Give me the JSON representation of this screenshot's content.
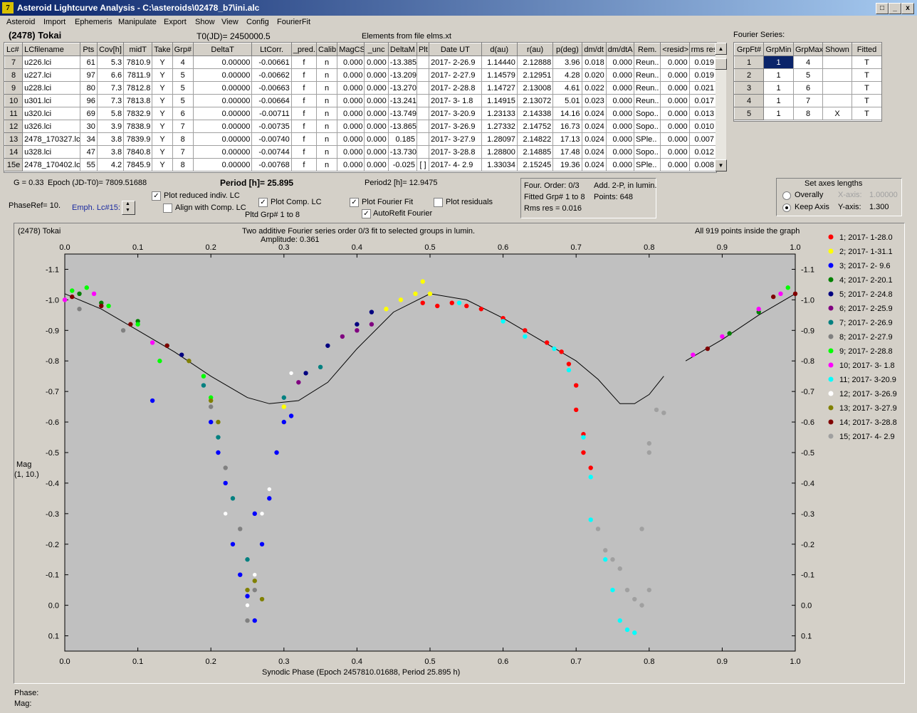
{
  "window": {
    "title": "Asteroid Lightcurve Analysis - C:\\asteroids\\02478_b7\\ini.alc",
    "icon": "7"
  },
  "menu": [
    "Asteroid",
    "Import",
    "Ephemeris",
    "Manipulate",
    "Export",
    "Show",
    "View",
    "Config",
    "FourierFit"
  ],
  "header": {
    "object": "(2478) Tokai",
    "t0": "T0(JD)= 2450000.5",
    "elements": "Elements from file elms.xt"
  },
  "table": {
    "columns": [
      "Lc#",
      "LCfilename",
      "Pts",
      "Cov[h]",
      "midT",
      "Take",
      "Grp#",
      "DeltaT",
      "LtCorr.",
      "_pred.",
      "Calib",
      "MagCS",
      "_unc",
      "DeltaM",
      "Plt",
      "Date UT",
      "d(au)",
      "r(au)",
      "p(deg)",
      "dm/dt",
      "dm/dtA",
      "Rem.",
      "<resid>",
      "rms res"
    ],
    "rows": [
      [
        "7",
        "u226.lci",
        "61",
        "5.3",
        "7810.9",
        "Y",
        "4",
        "0.00000",
        "-0.00661",
        "f",
        "n",
        "0.000",
        "0.000",
        "-13.385",
        "",
        "2017- 2-26.9",
        "1.14440",
        "2.12888",
        "3.96",
        "0.018",
        "0.000",
        "Reun..",
        "0.000",
        "0.019"
      ],
      [
        "8",
        "u227.lci",
        "97",
        "6.6",
        "7811.9",
        "Y",
        "5",
        "0.00000",
        "-0.00662",
        "f",
        "n",
        "0.000",
        "0.000",
        "-13.209",
        "",
        "2017- 2-27.9",
        "1.14579",
        "2.12951",
        "4.28",
        "0.020",
        "0.000",
        "Reun..",
        "0.000",
        "0.019"
      ],
      [
        "9",
        "u228.lci",
        "80",
        "7.3",
        "7812.8",
        "Y",
        "5",
        "0.00000",
        "-0.00663",
        "f",
        "n",
        "0.000",
        "0.000",
        "-13.270",
        "",
        "2017- 2-28.8",
        "1.14727",
        "2.13008",
        "4.61",
        "0.022",
        "0.000",
        "Reun..",
        "0.000",
        "0.021"
      ],
      [
        "10",
        "u301.lci",
        "96",
        "7.3",
        "7813.8",
        "Y",
        "5",
        "0.00000",
        "-0.00664",
        "f",
        "n",
        "0.000",
        "0.000",
        "-13.241",
        "",
        "2017- 3- 1.8",
        "1.14915",
        "2.13072",
        "5.01",
        "0.023",
        "0.000",
        "Reun..",
        "0.000",
        "0.017"
      ],
      [
        "11",
        "u320.lci",
        "69",
        "5.8",
        "7832.9",
        "Y",
        "6",
        "0.00000",
        "-0.00711",
        "f",
        "n",
        "0.000",
        "0.000",
        "-13.749",
        "",
        "2017- 3-20.9",
        "1.23133",
        "2.14338",
        "14.16",
        "0.024",
        "0.000",
        "Sopo..",
        "0.000",
        "0.013"
      ],
      [
        "12",
        "u326.lci",
        "30",
        "3.9",
        "7838.9",
        "Y",
        "7",
        "0.00000",
        "-0.00735",
        "f",
        "n",
        "0.000",
        "0.000",
        "-13.865",
        "",
        "2017- 3-26.9",
        "1.27332",
        "2.14752",
        "16.73",
        "0.024",
        "0.000",
        "Sopo..",
        "0.000",
        "0.010"
      ],
      [
        "13",
        "2478_170327.lc",
        "34",
        "3.8",
        "7839.9",
        "Y",
        "8",
        "0.00000",
        "-0.00740",
        "f",
        "n",
        "0.000",
        "0.000",
        "0.185",
        "",
        "2017- 3-27.9",
        "1.28097",
        "2.14822",
        "17.13",
        "0.024",
        "0.000",
        "SPle..",
        "0.000",
        "0.007"
      ],
      [
        "14",
        "u328.lci",
        "47",
        "3.8",
        "7840.8",
        "Y",
        "7",
        "0.00000",
        "-0.00744",
        "f",
        "n",
        "0.000",
        "0.000",
        "-13.730",
        "",
        "2017- 3-28.8",
        "1.28800",
        "2.14885",
        "17.48",
        "0.024",
        "0.000",
        "Sopo..",
        "0.000",
        "0.012"
      ],
      [
        "15e",
        "2478_170402.lc",
        "55",
        "4.2",
        "7845.9",
        "Y",
        "8",
        "0.00000",
        "-0.00768",
        "f",
        "n",
        "0.000",
        "0.000",
        "-0.025",
        "[ ]",
        "2017- 4- 2.9",
        "1.33034",
        "2.15245",
        "19.36",
        "0.024",
        "0.000",
        "SPle..",
        "0.000",
        "0.008"
      ]
    ]
  },
  "fourier_table": {
    "title": "Fourier Series:",
    "columns": [
      "GrpFt#",
      "GrpMin",
      "GrpMax",
      "Shown",
      "Fitted"
    ],
    "rows": [
      [
        "1",
        "1",
        "4",
        "",
        "T"
      ],
      [
        "2",
        "1",
        "5",
        "",
        "T"
      ],
      [
        "3",
        "1",
        "6",
        "",
        "T"
      ],
      [
        "4",
        "1",
        "7",
        "",
        "T"
      ],
      [
        "5",
        "1",
        "8",
        "X",
        "T"
      ]
    ]
  },
  "params": {
    "g": "G = 0.33",
    "epoch": "Epoch (JD-T0)= 7809.51688",
    "period": "Period [h]= 25.895",
    "period2": "Period2 [h]= 12.9475",
    "phaseref": "PhaseRef= 10.",
    "emph": "Emph. Lc#15:",
    "plot_reduced": "Plot reduced indiv. LC",
    "align": "Align with Comp. LC",
    "plot_comp": "Plot Comp. LC",
    "pltd_grp": "Pltd Grp#  1   to   8",
    "plot_fourier": "Plot Fourier Fit",
    "autorefit": "AutoRefit Fourier",
    "plot_residuals": "Plot residuals"
  },
  "fourier_info": {
    "order": "Four. Order:  0/3",
    "add": "Add. 2-P, in lumin.",
    "fitted": "Fitted Grp# 1 to 8",
    "points": "Points: 648",
    "rms": "Rms res    = 0.016"
  },
  "axes_panel": {
    "title": "Set axes lengths",
    "overally": "Overally",
    "keep": "Keep Axis",
    "xaxis_label": "X-axis:",
    "xaxis_val": "1.00000",
    "yaxis_label": "Y-axis:",
    "yaxis_val": "1.300"
  },
  "chart_data": {
    "type": "scatter",
    "title_left": "(2478) Tokai",
    "title": "Two additive Fourier series order 0/3 fit to selected groups in lumin.",
    "subtitle": "Amplitude: 0.361",
    "title_right": "All 919 points inside the graph",
    "xlabel": "Synodic Phase (Epoch 2457810.01688, Period 25.895 h)",
    "ylabel": "Mag",
    "ylabel2": "(1, 10.)",
    "xlim": [
      0,
      1
    ],
    "ylim": [
      -1.15,
      0.15
    ],
    "xticks": [
      "0.0",
      "0.1",
      "0.2",
      "0.3",
      "0.4",
      "0.5",
      "0.6",
      "0.7",
      "0.8",
      "0.9",
      "1.0"
    ],
    "yticks": [
      "-1.1",
      "-1.0",
      "-0.9",
      "-0.8",
      "-0.7",
      "-0.6",
      "-0.5",
      "-0.4",
      "-0.3",
      "-0.2",
      "-0.1",
      "0.0",
      "0.1"
    ],
    "legend": [
      {
        "label": "1; 2017- 1-28.0",
        "color": "#ff0000"
      },
      {
        "label": "2; 2017- 1-31.1",
        "color": "#ffff00"
      },
      {
        "label": "3; 2017- 2- 9.6",
        "color": "#0000ff"
      },
      {
        "label": "4; 2017- 2-20.1",
        "color": "#008000"
      },
      {
        "label": "5; 2017- 2-24.8",
        "color": "#000080"
      },
      {
        "label": "6; 2017- 2-25.9",
        "color": "#800080"
      },
      {
        "label": "7; 2017- 2-26.9",
        "color": "#008080"
      },
      {
        "label": "8; 2017- 2-27.9",
        "color": "#808080"
      },
      {
        "label": "9; 2017- 2-28.8",
        "color": "#00ff00"
      },
      {
        "label": "10; 2017- 3- 1.8",
        "color": "#ff00ff"
      },
      {
        "label": "11; 2017- 3-20.9",
        "color": "#00ffff"
      },
      {
        "label": "12; 2017- 3-26.9",
        "color": "#ffffff"
      },
      {
        "label": "13; 2017- 3-27.9",
        "color": "#808000"
      },
      {
        "label": "14; 2017- 3-28.8",
        "color": "#800000"
      },
      {
        "label": "15; 2017- 4- 2.9",
        "color": "#a0a0a0"
      }
    ],
    "fit_curve": [
      [
        0,
        -1.02
      ],
      [
        0.05,
        -0.97
      ],
      [
        0.1,
        -0.9
      ],
      [
        0.15,
        -0.83
      ],
      [
        0.2,
        -0.75
      ],
      [
        0.25,
        -0.68
      ],
      [
        0.28,
        -0.66
      ],
      [
        0.32,
        -0.67
      ],
      [
        0.36,
        -0.73
      ],
      [
        0.4,
        -0.84
      ],
      [
        0.45,
        -0.96
      ],
      [
        0.5,
        -1.02
      ],
      [
        0.55,
        -1.0
      ],
      [
        0.6,
        -0.94
      ],
      [
        0.65,
        -0.87
      ],
      [
        0.7,
        -0.8
      ],
      [
        0.73,
        -0.74
      ],
      [
        0.76,
        -0.66
      ],
      [
        0.78,
        -0.66
      ],
      [
        0.8,
        -0.69
      ],
      [
        0.82,
        -0.75
      ]
    ],
    "fit_curve2": [
      [
        0.85,
        -0.8
      ],
      [
        0.9,
        -0.87
      ],
      [
        0.95,
        -0.95
      ],
      [
        1.0,
        -1.02
      ]
    ],
    "series": [
      {
        "group": 1,
        "points": [
          [
            0.49,
            -0.99
          ],
          [
            0.51,
            -0.98
          ],
          [
            0.53,
            -0.99
          ],
          [
            0.55,
            -0.98
          ],
          [
            0.57,
            -0.97
          ],
          [
            0.6,
            -0.94
          ],
          [
            0.63,
            -0.9
          ],
          [
            0.66,
            -0.86
          ],
          [
            0.68,
            -0.83
          ],
          [
            0.69,
            -0.79
          ],
          [
            0.7,
            -0.72
          ],
          [
            0.7,
            -0.64
          ],
          [
            0.71,
            -0.56
          ],
          [
            0.71,
            -0.5
          ],
          [
            0.72,
            -0.45
          ]
        ]
      },
      {
        "group": 2,
        "points": [
          [
            0.44,
            -0.97
          ],
          [
            0.46,
            -1.0
          ],
          [
            0.48,
            -1.02
          ],
          [
            0.49,
            -1.06
          ],
          [
            0.5,
            -1.02
          ],
          [
            0.3,
            -0.65
          ],
          [
            0.3,
            -0.6
          ]
        ]
      },
      {
        "group": 3,
        "points": [
          [
            0.12,
            -0.67
          ],
          [
            0.2,
            -0.6
          ],
          [
            0.21,
            -0.5
          ],
          [
            0.22,
            -0.4
          ],
          [
            0.22,
            -0.3
          ],
          [
            0.23,
            -0.2
          ],
          [
            0.24,
            -0.1
          ],
          [
            0.25,
            -0.03
          ],
          [
            0.26,
            0.05
          ],
          [
            0.27,
            -0.2
          ],
          [
            0.28,
            -0.35
          ],
          [
            0.29,
            -0.5
          ],
          [
            0.3,
            -0.6
          ],
          [
            0.31,
            -0.62
          ],
          [
            0.26,
            -0.3
          ]
        ]
      },
      {
        "group": 4,
        "points": [
          [
            0.02,
            -1.02
          ],
          [
            0.05,
            -0.99
          ],
          [
            0.1,
            -0.93
          ],
          [
            0.14,
            -0.85
          ],
          [
            0.91,
            -0.89
          ],
          [
            0.95,
            -0.96
          ]
        ]
      },
      {
        "group": 5,
        "points": [
          [
            0.16,
            -0.82
          ],
          [
            0.33,
            -0.76
          ],
          [
            0.36,
            -0.85
          ],
          [
            0.4,
            -0.92
          ],
          [
            0.42,
            -0.96
          ]
        ]
      },
      {
        "group": 6,
        "points": [
          [
            0.32,
            -0.73
          ],
          [
            0.38,
            -0.88
          ],
          [
            0.4,
            -0.9
          ],
          [
            0.42,
            -0.92
          ]
        ]
      },
      {
        "group": 7,
        "points": [
          [
            0.19,
            -0.72
          ],
          [
            0.21,
            -0.55
          ],
          [
            0.23,
            -0.35
          ],
          [
            0.25,
            -0.15
          ],
          [
            0.3,
            -0.68
          ],
          [
            0.35,
            -0.78
          ]
        ]
      },
      {
        "group": 8,
        "points": [
          [
            0.02,
            -0.97
          ],
          [
            0.08,
            -0.9
          ],
          [
            0.2,
            -0.65
          ],
          [
            0.22,
            -0.45
          ],
          [
            0.24,
            -0.25
          ],
          [
            0.25,
            0.05
          ],
          [
            0.26,
            -0.05
          ]
        ]
      },
      {
        "group": 9,
        "points": [
          [
            0.01,
            -1.03
          ],
          [
            0.03,
            -1.04
          ],
          [
            0.06,
            -0.98
          ],
          [
            0.1,
            -0.92
          ],
          [
            0.13,
            -0.8
          ],
          [
            0.19,
            -0.75
          ],
          [
            0.2,
            -0.68
          ],
          [
            0.99,
            -1.04
          ]
        ]
      },
      {
        "group": 10,
        "points": [
          [
            0.0,
            -1.0
          ],
          [
            0.04,
            -1.02
          ],
          [
            0.12,
            -0.86
          ],
          [
            0.86,
            -0.82
          ],
          [
            0.9,
            -0.88
          ],
          [
            0.95,
            -0.97
          ],
          [
            0.98,
            -1.02
          ]
        ]
      },
      {
        "group": 11,
        "points": [
          [
            0.54,
            -0.99
          ],
          [
            0.6,
            -0.93
          ],
          [
            0.63,
            -0.88
          ],
          [
            0.67,
            -0.84
          ],
          [
            0.69,
            -0.77
          ],
          [
            0.71,
            -0.55
          ],
          [
            0.72,
            -0.42
          ],
          [
            0.72,
            -0.28
          ],
          [
            0.74,
            -0.15
          ],
          [
            0.75,
            -0.05
          ],
          [
            0.76,
            0.05
          ],
          [
            0.77,
            0.08
          ],
          [
            0.78,
            0.09
          ]
        ]
      },
      {
        "group": 12,
        "points": [
          [
            0.22,
            -0.3
          ],
          [
            0.25,
            0.0
          ],
          [
            0.26,
            -0.1
          ],
          [
            0.27,
            -0.3
          ],
          [
            0.28,
            -0.38
          ],
          [
            0.31,
            -0.76
          ]
        ]
      },
      {
        "group": 13,
        "points": [
          [
            0.17,
            -0.8
          ],
          [
            0.2,
            -0.67
          ],
          [
            0.21,
            -0.6
          ],
          [
            0.25,
            -0.05
          ],
          [
            0.26,
            -0.08
          ],
          [
            0.27,
            -0.02
          ]
        ]
      },
      {
        "group": 14,
        "points": [
          [
            0.01,
            -1.01
          ],
          [
            0.05,
            -0.98
          ],
          [
            0.09,
            -0.92
          ],
          [
            0.14,
            -0.85
          ],
          [
            0.88,
            -0.84
          ],
          [
            0.97,
            -1.01
          ],
          [
            1.0,
            -1.02
          ]
        ]
      },
      {
        "group": 15,
        "points": [
          [
            0.73,
            -0.25
          ],
          [
            0.74,
            -0.18
          ],
          [
            0.75,
            -0.15
          ],
          [
            0.76,
            -0.12
          ],
          [
            0.77,
            -0.05
          ],
          [
            0.78,
            -0.02
          ],
          [
            0.79,
            0.0
          ],
          [
            0.8,
            -0.05
          ],
          [
            0.79,
            -0.25
          ],
          [
            0.8,
            -0.5
          ],
          [
            0.8,
            -0.53
          ],
          [
            0.81,
            -0.64
          ],
          [
            0.82,
            -0.63
          ]
        ]
      }
    ]
  },
  "status": {
    "phase": "Phase:",
    "mag": "Mag:"
  }
}
